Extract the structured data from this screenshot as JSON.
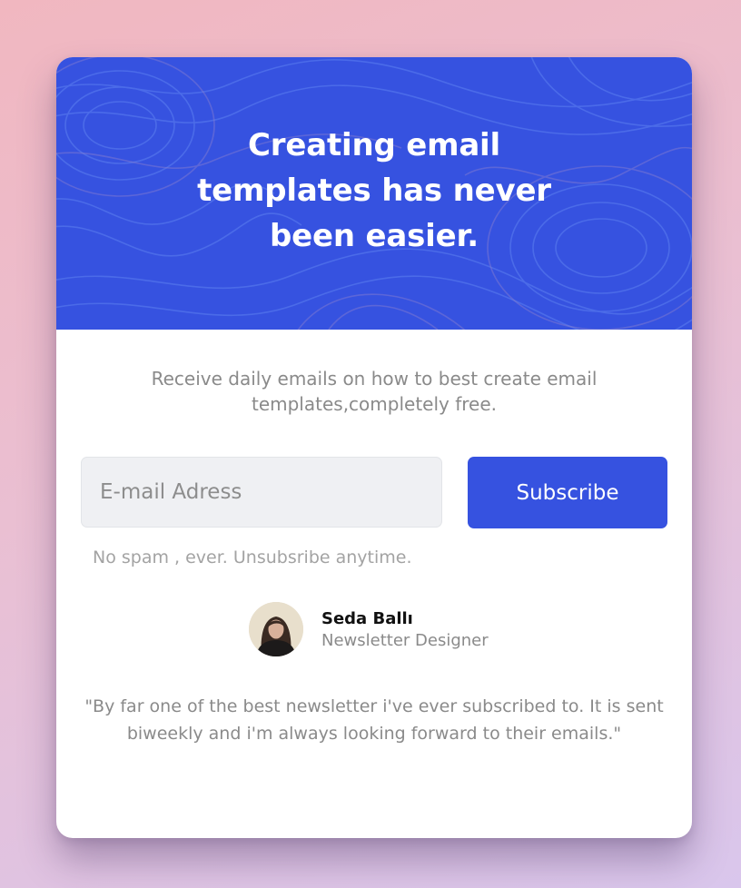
{
  "hero": {
    "title": "Creating email templates has never been easier."
  },
  "subtitle": "Receive daily emails on how to best create email templates,completely free.",
  "form": {
    "email_placeholder": "E-mail Adress",
    "subscribe_label": "Subscribe",
    "note": "No spam , ever. Unsubsribe anytime."
  },
  "author": {
    "name": "Seda Ballı",
    "role": "Newsletter Designer",
    "avatar_icon": "avatar-photo"
  },
  "testimonial": {
    "quote": "\"By far one of the best newsletter i've ever subscribed to. It is sent biweekly and i'm always looking forward to their emails.\""
  },
  "colors": {
    "accent": "#3652e0",
    "text_muted": "#8a8a8a",
    "input_bg": "#eff0f3"
  }
}
